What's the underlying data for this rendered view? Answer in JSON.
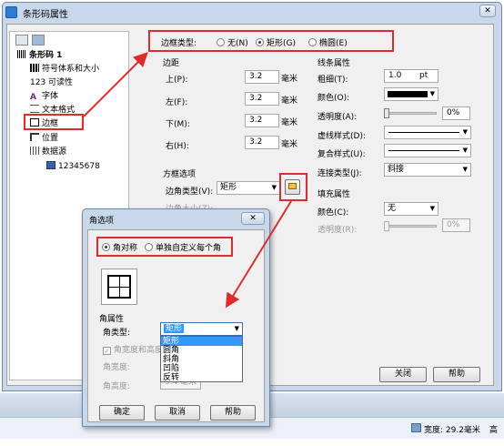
{
  "window": {
    "title": "条形码属性",
    "close": "✕"
  },
  "tree": {
    "items": [
      {
        "label": "条形码 1"
      },
      {
        "label": "符号体系和大小"
      },
      {
        "label": "123 可读性"
      },
      {
        "label": "字体"
      },
      {
        "label": "文本格式"
      },
      {
        "label": "边框"
      },
      {
        "label": "位置"
      },
      {
        "label": "数据源"
      },
      {
        "label": "12345678"
      }
    ]
  },
  "border_type": {
    "label": "边框类型:",
    "options": [
      "无(N)",
      "矩形(G)",
      "椭圆(E)"
    ],
    "selected": "矩形(G)"
  },
  "margins": {
    "title": "边距",
    "rows": [
      {
        "label": "上(P):",
        "value": "3.2",
        "unit": "毫米"
      },
      {
        "label": "左(F):",
        "value": "3.2",
        "unit": "毫米"
      },
      {
        "label": "下(M):",
        "value": "3.2",
        "unit": "毫米"
      },
      {
        "label": "右(H):",
        "value": "3.2",
        "unit": "毫米"
      }
    ]
  },
  "box_options": {
    "title": "方框选项",
    "corner_type_label": "边角类型(V):",
    "corner_type_value": "矩形",
    "corner_size_label": "边角大小(Z):"
  },
  "line_props": {
    "title": "线条属性",
    "thickness_label": "粗细(T):",
    "thickness_value": "1.0",
    "thickness_unit": "pt",
    "color_label": "颜色(O):",
    "transparency_label": "透明度(A):",
    "transparency_value": "0%",
    "transparency_level": 0,
    "dash_label": "虚线样式(D):",
    "compound_label": "复合样式(U):",
    "join_label": "连接类型(J):",
    "join_value": "斜接"
  },
  "fill_props": {
    "title": "填充属性",
    "color_label": "颜色(C):",
    "color_value": "无",
    "transparency_label": "透明度(R):",
    "transparency_value": "0%"
  },
  "buttons": {
    "close": "关闭",
    "help": "帮助"
  },
  "dialog": {
    "title": "角选项",
    "close": "✕",
    "symmetric": "角对称",
    "custom": "单独自定义每个角",
    "corner_props_title": "角属性",
    "corner_type_label": "角类型:",
    "corner_type_value": "矩形",
    "dropdown_options": [
      "矩形",
      "圆角",
      "斜角",
      "凹陷",
      "反转"
    ],
    "equal_checkbox": "角宽度和高度相等",
    "width_label": "角宽度:",
    "height_label": "角高度:",
    "height_value": "3.4 毫米",
    "ok": "确定",
    "cancel": "取消",
    "help": "帮助"
  },
  "status": {
    "width_text": "宽度: 29.2毫米",
    "height_text": "高"
  },
  "colors": {
    "accent": "#e02b2b",
    "selection": "#3399ff",
    "line_color": "#000000"
  }
}
